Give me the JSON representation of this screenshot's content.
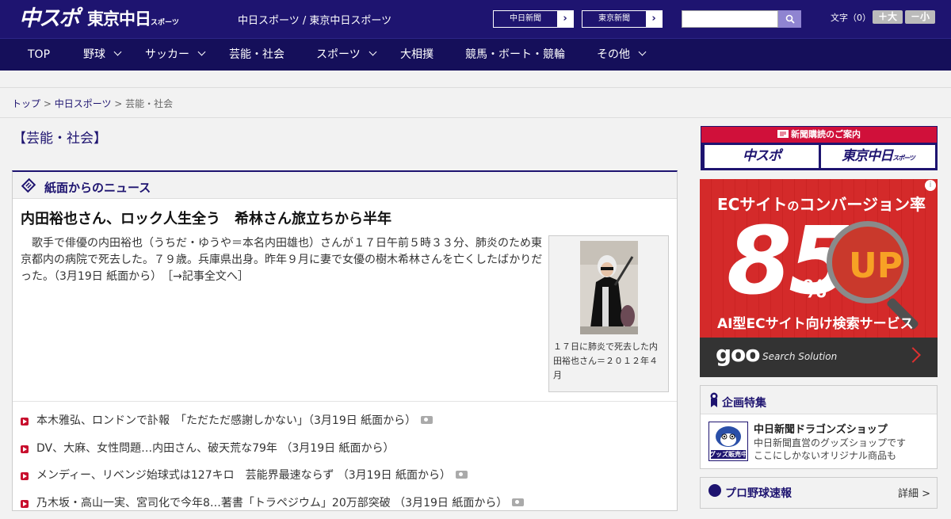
{
  "header": {
    "logo_chunichi": "中スポ",
    "logo_tokyo": "東京中日",
    "logo_tokyo_small": "スポーツ",
    "site_title": "中日スポーツ / 東京中日スポーツ",
    "ext_links": [
      "中日新聞",
      "東京新聞"
    ],
    "font_size_label": "文字（0）",
    "font_up": "＋大",
    "font_down": "－小"
  },
  "nav": {
    "items": [
      {
        "label": "TOP"
      },
      {
        "label": "野球"
      },
      {
        "label": "サッカー"
      },
      {
        "label": "芸能・社会"
      },
      {
        "label": "スポーツ"
      },
      {
        "label": "大相撲"
      },
      {
        "label": "競馬・ボート・競輪"
      },
      {
        "label": "その他"
      }
    ]
  },
  "breadcrumb": {
    "home": "トップ",
    "section": "中日スポーツ",
    "current": "芸能・社会",
    "sep": " > "
  },
  "page": {
    "heading": "【芸能・社会】"
  },
  "news": {
    "section_title": "紙面からのニュース",
    "headline": "内田裕也さん、ロック人生全う　希林さん旅立ちから半年",
    "lead": "歌手で俳優の内田裕也（うちだ・ゆうや＝本名内田雄也）さんが１７日午前５時３３分、肺炎のため東京都内の病院で死去した。７９歳。兵庫県出身。昨年９月に妻で女優の樹木希林さんを亡くしたばかりだった。（3月19日 紙面から）",
    "read_more": "［→記事全文へ］",
    "photo_caption": "１７日に肺炎で死去した内田裕也さん＝２０１２年４月",
    "list": [
      {
        "text": "本木雅弘、ロンドンで訃報　「ただただ感謝しかない」（3月19日 紙面から）",
        "photo": true
      },
      {
        "text": "DV、大麻、女性問題…内田さん、破天荒な79年 （3月19日 紙面から）",
        "photo": false
      },
      {
        "text": "メンディー、リベンジ始球式は127キロ　芸能界最速ならず （3月19日 紙面から）",
        "photo": true
      },
      {
        "text": "乃木坂・高山一実、宮司化で今年8…著書「トラペジウム」20万部突破 （3月19日 紙面から）",
        "photo": true
      }
    ]
  },
  "sidebar": {
    "subscribe_bar": "新聞購読のご案内",
    "subscribe_chunichi": "中スポ",
    "subscribe_tokyo": "東京中日",
    "subscribe_tokyo_small": "スポーツ",
    "ad": {
      "headline_1": "ECサイト",
      "headline_2": "の",
      "headline_3": "コンバージョン率",
      "big_number": "85",
      "pct": "%",
      "up": "UP",
      "sub": "AI型ECサイト向け検索サービス",
      "brand": "goo",
      "brand_sub": "Search Solution",
      "info": "i"
    },
    "feature_title": "企画特集",
    "shop_name": "中日新聞ドラゴンズショップ",
    "shop_desc_1": "中日新聞直営のグッズショップです",
    "shop_desc_2": "ここにしかないオリジナル商品も",
    "shop_thumb_label": "グッズ販売中",
    "baseball_title": "プロ野球速報",
    "baseball_more": "詳細 >"
  },
  "colors": {
    "brand_navy": "#1e1470",
    "bullet_red": "#c8102e",
    "ad_red": "#d42a2a"
  }
}
